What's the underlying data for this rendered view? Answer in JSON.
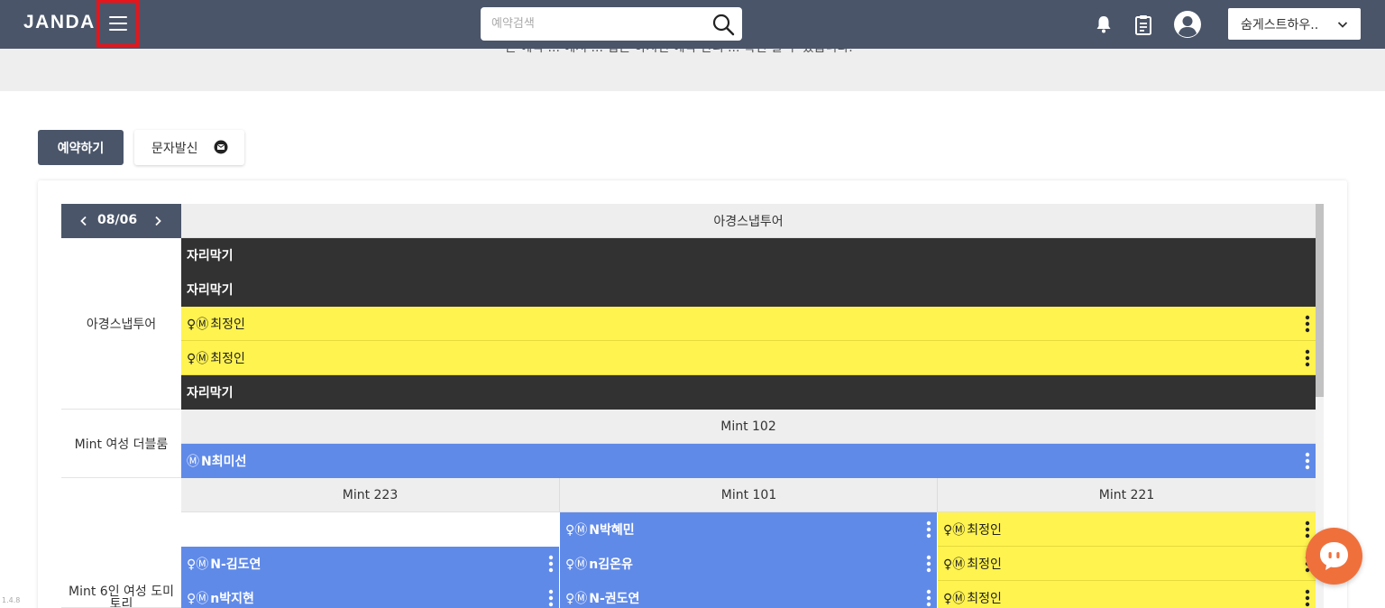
{
  "header": {
    "logo": "JANDA",
    "search_placeholder": "예약검색",
    "store_name": "숨게스트하우.."
  },
  "banner": {
    "text": "본 예약 ... 에서 ... 접근 하시면 예약 관리 ... 확인 할 수 있습니다."
  },
  "actions": {
    "reserve_label": "예약하기",
    "sms_label": "문자발신"
  },
  "calendar": {
    "date": "08/06",
    "groups": [
      {
        "name": "아경스냅투어",
        "rooms": [
          {
            "name": "아경스냅투어",
            "rows": [
              {
                "type": "block",
                "label": "자리막기"
              },
              {
                "type": "block",
                "label": "자리막기"
              },
              {
                "type": "yellow",
                "icons": "♀Ⓜ",
                "label": "최정인"
              },
              {
                "type": "yellow",
                "icons": "♀Ⓜ",
                "label": "최정인"
              },
              {
                "type": "block",
                "label": "자리막기"
              }
            ]
          }
        ]
      },
      {
        "name": "Mint 여성 더블룸",
        "rooms": [
          {
            "name": "Mint 102",
            "rows": [
              {
                "type": "blue",
                "icons": "Ⓜ",
                "label": "N최미선"
              }
            ]
          }
        ]
      },
      {
        "name": "Mint 6인 여성 도미토리",
        "rooms": [
          {
            "name": "Mint 223",
            "rows": [
              {
                "type": "empty",
                "label": ""
              },
              {
                "type": "blue",
                "icons": "♀Ⓜ",
                "label": "N-김도연"
              },
              {
                "type": "blue",
                "icons": "♀Ⓜ",
                "label": "n박지현"
              }
            ]
          },
          {
            "name": "Mint 101",
            "rows": [
              {
                "type": "blue",
                "icons": "♀Ⓜ",
                "label": "N박혜민"
              },
              {
                "type": "blue",
                "icons": "♀Ⓜ",
                "label": "n김온유"
              },
              {
                "type": "blue",
                "icons": "♀Ⓜ",
                "label": "N-권도연"
              }
            ]
          },
          {
            "name": "Mint 221",
            "rows": [
              {
                "type": "yellow",
                "icons": "♀Ⓜ",
                "label": "최정인"
              },
              {
                "type": "yellow",
                "icons": "♀Ⓜ",
                "label": "최정인"
              },
              {
                "type": "yellow",
                "icons": "♀Ⓜ",
                "label": "최정인"
              }
            ]
          }
        ]
      }
    ]
  },
  "footer": {
    "version": "1.4.8"
  },
  "colors": {
    "header_bg": "#4a5569",
    "block": "#323232",
    "yellow": "#fff34f",
    "blue": "#608ae8",
    "chat": "#f0703c",
    "highlight": "#e8141a"
  }
}
